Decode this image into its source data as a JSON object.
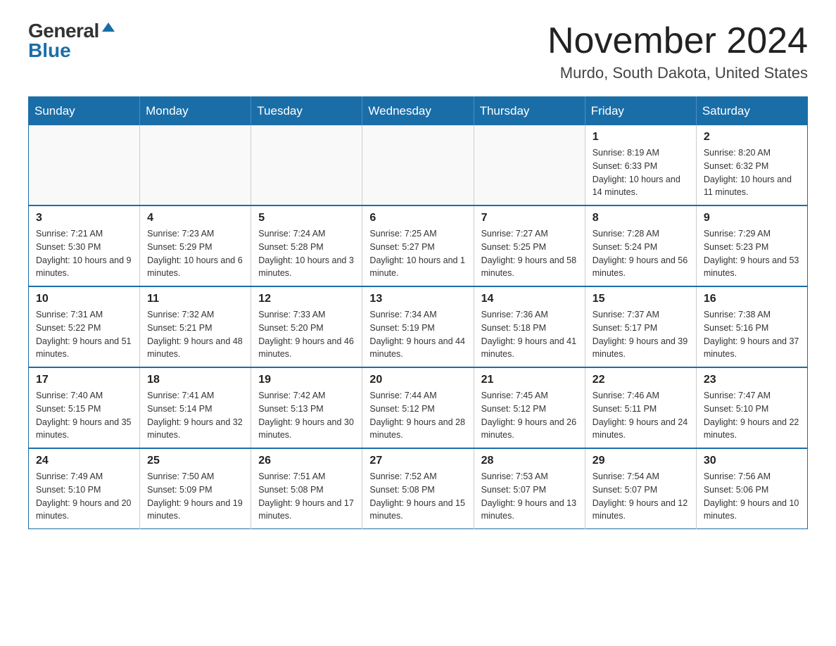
{
  "logo": {
    "general": "General",
    "blue": "Blue",
    "triangle": "▶"
  },
  "title": {
    "month_year": "November 2024",
    "location": "Murdo, South Dakota, United States"
  },
  "days_of_week": [
    "Sunday",
    "Monday",
    "Tuesday",
    "Wednesday",
    "Thursday",
    "Friday",
    "Saturday"
  ],
  "weeks": [
    [
      {
        "day": "",
        "info": ""
      },
      {
        "day": "",
        "info": ""
      },
      {
        "day": "",
        "info": ""
      },
      {
        "day": "",
        "info": ""
      },
      {
        "day": "",
        "info": ""
      },
      {
        "day": "1",
        "info": "Sunrise: 8:19 AM\nSunset: 6:33 PM\nDaylight: 10 hours and 14 minutes."
      },
      {
        "day": "2",
        "info": "Sunrise: 8:20 AM\nSunset: 6:32 PM\nDaylight: 10 hours and 11 minutes."
      }
    ],
    [
      {
        "day": "3",
        "info": "Sunrise: 7:21 AM\nSunset: 5:30 PM\nDaylight: 10 hours and 9 minutes."
      },
      {
        "day": "4",
        "info": "Sunrise: 7:23 AM\nSunset: 5:29 PM\nDaylight: 10 hours and 6 minutes."
      },
      {
        "day": "5",
        "info": "Sunrise: 7:24 AM\nSunset: 5:28 PM\nDaylight: 10 hours and 3 minutes."
      },
      {
        "day": "6",
        "info": "Sunrise: 7:25 AM\nSunset: 5:27 PM\nDaylight: 10 hours and 1 minute."
      },
      {
        "day": "7",
        "info": "Sunrise: 7:27 AM\nSunset: 5:25 PM\nDaylight: 9 hours and 58 minutes."
      },
      {
        "day": "8",
        "info": "Sunrise: 7:28 AM\nSunset: 5:24 PM\nDaylight: 9 hours and 56 minutes."
      },
      {
        "day": "9",
        "info": "Sunrise: 7:29 AM\nSunset: 5:23 PM\nDaylight: 9 hours and 53 minutes."
      }
    ],
    [
      {
        "day": "10",
        "info": "Sunrise: 7:31 AM\nSunset: 5:22 PM\nDaylight: 9 hours and 51 minutes."
      },
      {
        "day": "11",
        "info": "Sunrise: 7:32 AM\nSunset: 5:21 PM\nDaylight: 9 hours and 48 minutes."
      },
      {
        "day": "12",
        "info": "Sunrise: 7:33 AM\nSunset: 5:20 PM\nDaylight: 9 hours and 46 minutes."
      },
      {
        "day": "13",
        "info": "Sunrise: 7:34 AM\nSunset: 5:19 PM\nDaylight: 9 hours and 44 minutes."
      },
      {
        "day": "14",
        "info": "Sunrise: 7:36 AM\nSunset: 5:18 PM\nDaylight: 9 hours and 41 minutes."
      },
      {
        "day": "15",
        "info": "Sunrise: 7:37 AM\nSunset: 5:17 PM\nDaylight: 9 hours and 39 minutes."
      },
      {
        "day": "16",
        "info": "Sunrise: 7:38 AM\nSunset: 5:16 PM\nDaylight: 9 hours and 37 minutes."
      }
    ],
    [
      {
        "day": "17",
        "info": "Sunrise: 7:40 AM\nSunset: 5:15 PM\nDaylight: 9 hours and 35 minutes."
      },
      {
        "day": "18",
        "info": "Sunrise: 7:41 AM\nSunset: 5:14 PM\nDaylight: 9 hours and 32 minutes."
      },
      {
        "day": "19",
        "info": "Sunrise: 7:42 AM\nSunset: 5:13 PM\nDaylight: 9 hours and 30 minutes."
      },
      {
        "day": "20",
        "info": "Sunrise: 7:44 AM\nSunset: 5:12 PM\nDaylight: 9 hours and 28 minutes."
      },
      {
        "day": "21",
        "info": "Sunrise: 7:45 AM\nSunset: 5:12 PM\nDaylight: 9 hours and 26 minutes."
      },
      {
        "day": "22",
        "info": "Sunrise: 7:46 AM\nSunset: 5:11 PM\nDaylight: 9 hours and 24 minutes."
      },
      {
        "day": "23",
        "info": "Sunrise: 7:47 AM\nSunset: 5:10 PM\nDaylight: 9 hours and 22 minutes."
      }
    ],
    [
      {
        "day": "24",
        "info": "Sunrise: 7:49 AM\nSunset: 5:10 PM\nDaylight: 9 hours and 20 minutes."
      },
      {
        "day": "25",
        "info": "Sunrise: 7:50 AM\nSunset: 5:09 PM\nDaylight: 9 hours and 19 minutes."
      },
      {
        "day": "26",
        "info": "Sunrise: 7:51 AM\nSunset: 5:08 PM\nDaylight: 9 hours and 17 minutes."
      },
      {
        "day": "27",
        "info": "Sunrise: 7:52 AM\nSunset: 5:08 PM\nDaylight: 9 hours and 15 minutes."
      },
      {
        "day": "28",
        "info": "Sunrise: 7:53 AM\nSunset: 5:07 PM\nDaylight: 9 hours and 13 minutes."
      },
      {
        "day": "29",
        "info": "Sunrise: 7:54 AM\nSunset: 5:07 PM\nDaylight: 9 hours and 12 minutes."
      },
      {
        "day": "30",
        "info": "Sunrise: 7:56 AM\nSunset: 5:06 PM\nDaylight: 9 hours and 10 minutes."
      }
    ]
  ]
}
